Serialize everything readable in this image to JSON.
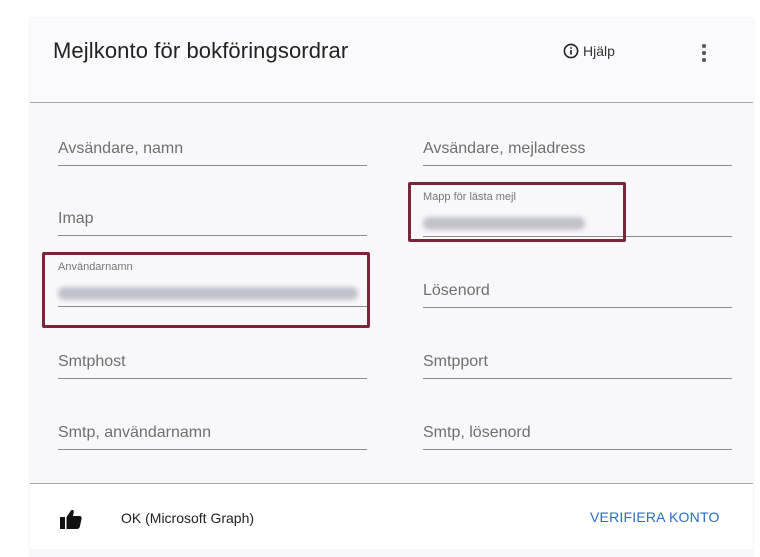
{
  "top_fragment": "",
  "header": {
    "title": "Mejlkonto för bokföringsordrar",
    "help_label": "Hjälp"
  },
  "fields": {
    "sender_name": {
      "label": "Avsändare, namn"
    },
    "sender_email": {
      "label": "Avsändare, mejladress"
    },
    "imap": {
      "label": "Imap"
    },
    "read_folder": {
      "label": "Mapp för lästa mejl"
    },
    "username": {
      "label": "Användarnamn"
    },
    "password": {
      "label": "Lösenord"
    },
    "smtp_host": {
      "label": "Smtphost"
    },
    "smtp_port": {
      "label": "Smtpport"
    },
    "smtp_username": {
      "label": "Smtp, användarnamn"
    },
    "smtp_password": {
      "label": "Smtp, lösenord"
    }
  },
  "footer": {
    "status": "OK (Microsoft Graph)",
    "verify_label": "VERIFIERA KONTO"
  },
  "colors": {
    "accent": "#2a6dbf",
    "highlight_border": "#7b2638",
    "card_background": "#f8f8fb"
  },
  "icons": {
    "help": "info-circle-icon",
    "more": "vertical-dots-icon",
    "status": "thumbs-up-icon"
  }
}
